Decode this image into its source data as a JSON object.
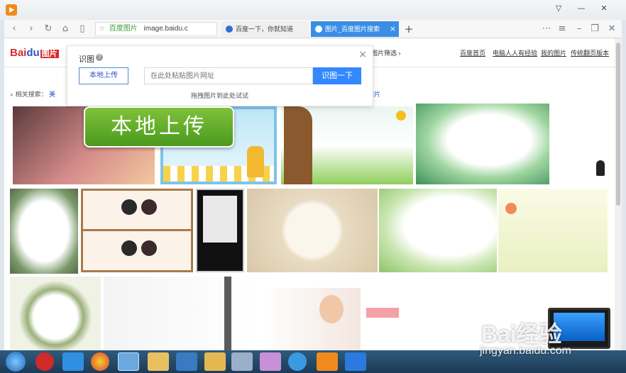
{
  "browser": {
    "address_site": "百度图片",
    "address_url": "image.baidu.c",
    "tabs": [
      {
        "label": "百度一下，你就知道",
        "active": false
      },
      {
        "label": "图片_百度图片搜索",
        "active": true
      }
    ],
    "accent": "#3a8ee6"
  },
  "page": {
    "logo_text": "Bai",
    "logo_paw": "du",
    "logo_pic": "图片",
    "filter_label": "图片筛选",
    "top_links": [
      "百度首页",
      "电脑人人有经验",
      "我的图片",
      "传统翻页版本"
    ],
    "related_label": "相关搜索：",
    "related_first": "美",
    "related_tail": "图片"
  },
  "popup": {
    "title": "识图",
    "help": "?",
    "upload_label": "本地上传",
    "url_placeholder": "在此处粘贴图片网址",
    "recognize_label": "识图一下",
    "drag_hint": "拖拽图片到此处试试"
  },
  "callout": {
    "text": "本地上传"
  },
  "watermark": {
    "logo": "Bai经验",
    "url": "jingyan.baidu.com"
  },
  "colors": {
    "primary_blue": "#3388ff",
    "callout_green": "#6ab42e",
    "baidu_red": "#d92c2c"
  }
}
